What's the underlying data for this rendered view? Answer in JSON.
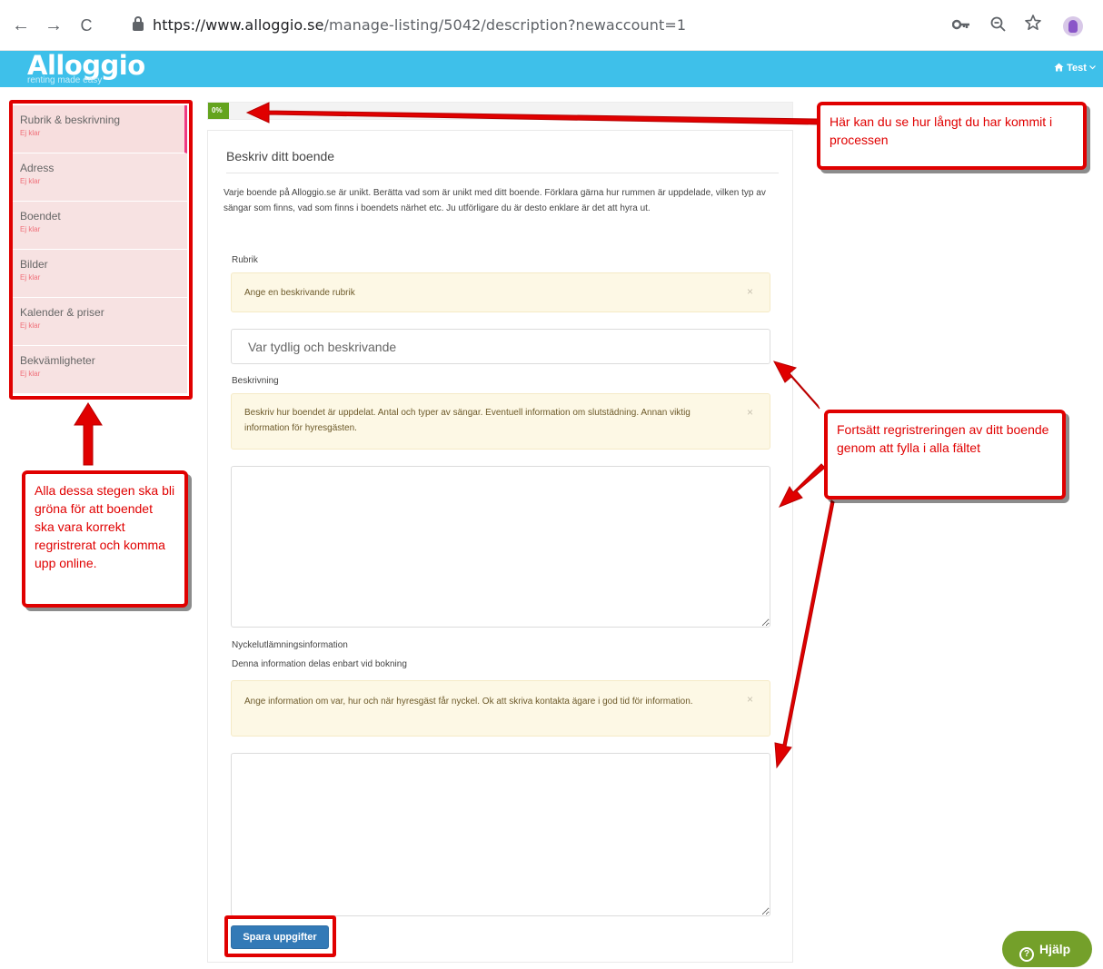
{
  "browser": {
    "url_host": "https://www.alloggio.se",
    "url_path": "/manage-listing/5042/description?newaccount=1",
    "back_glyph": "←",
    "forward_glyph": "→",
    "reload_glyph": "C",
    "icons": [
      "back-arrow-icon",
      "forward-arrow-icon",
      "reload-icon",
      "lock-icon",
      "key-icon",
      "zoom-icon",
      "star-icon",
      "profile-avatar"
    ]
  },
  "header": {
    "logo": "Alloggio",
    "tagline": "renting made easy",
    "user_menu": "Test",
    "user_icon": "home-icon",
    "background": "#3ec0ea"
  },
  "sidebar": {
    "items": [
      {
        "label": "Rubrik & beskrivning",
        "status": "Ej klar"
      },
      {
        "label": "Adress",
        "status": "Ej klar"
      },
      {
        "label": "Boendet",
        "status": "Ej klar"
      },
      {
        "label": "Bilder",
        "status": "Ej klar"
      },
      {
        "label": "Kalender & priser",
        "status": "Ej klar"
      },
      {
        "label": "Bekvämligheter",
        "status": "Ej klar"
      }
    ]
  },
  "progress": {
    "value": 0,
    "label": "0%"
  },
  "main": {
    "title": "Beskriv ditt boende",
    "intro": "Varje boende på Alloggio.se är unikt. Berätta vad som är unikt med ditt boende. Förklara gärna hur rummen är uppdelade, vilken typ av sängar som finns, vad som finns i boendets närhet etc. Ju utförligare du är desto enklare är det att hyra ut.",
    "rubrik": {
      "label": "Rubrik",
      "hint": "Ange en beskrivande rubrik",
      "placeholder": "Var tydlig och beskrivande",
      "value": ""
    },
    "beskrivning": {
      "label": "Beskrivning",
      "hint": "Beskriv hur boendet är uppdelat. Antal och typer av sängar. Eventuell information om slutstädning. Annan viktig information för hyresgästen.",
      "value": ""
    },
    "nyckel": {
      "label": "Nyckelutlämningsinformation",
      "sublabel": "Denna information delas enbart vid bokning",
      "hint": "Ange information om var, hur och när hyresgäst får nyckel. Ok att skriva kontakta ägare i god tid för information.",
      "value": ""
    },
    "dismiss_glyph": "×",
    "save_label": "Spara uppgifter"
  },
  "annotations": {
    "progress_note": "Här kan du se hur långt du har kommit i processen",
    "steps_note": "Alla dessa stegen ska bli gröna för att boendet ska vara korrekt regristrerat och komma upp online.",
    "fields_note": "Fortsätt regristreringen av ditt boende genom att fylla i alla fältet"
  },
  "help": {
    "label": "Hjälp",
    "icon": "question-circle-icon"
  }
}
